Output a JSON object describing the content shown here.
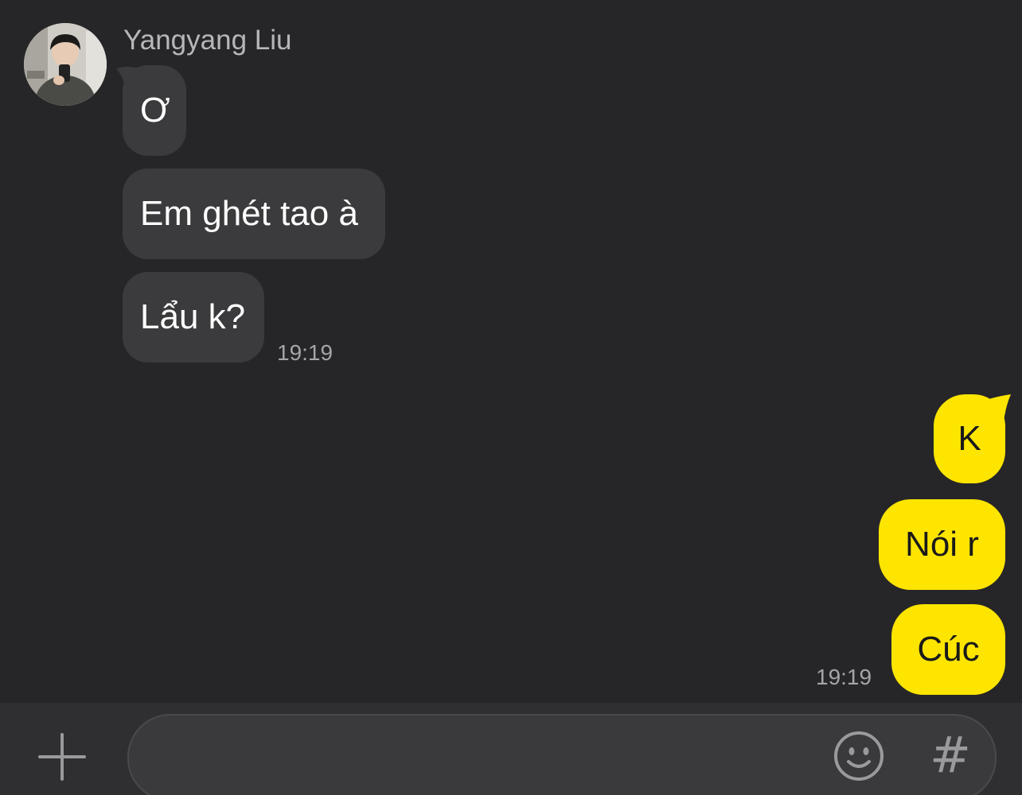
{
  "conversation": {
    "sender": {
      "name": "Yangyang Liu",
      "avatar": "profile-photo"
    },
    "incoming_messages": [
      {
        "text": "Ơ"
      },
      {
        "text": "Em ghét tao à"
      },
      {
        "text": "Lẩu k?"
      }
    ],
    "incoming_time": "19:19",
    "outgoing_messages": [
      {
        "text": "K"
      },
      {
        "text": "Nói r"
      },
      {
        "text": "Cúc"
      }
    ],
    "outgoing_time": "19:19"
  },
  "composer": {
    "value": "",
    "placeholder": "",
    "icons": {
      "attach": "plus-icon",
      "emoji": "emoji-icon",
      "hashtag": "hashtag-icon"
    },
    "hashtag_symbol": "#"
  },
  "colors": {
    "background": "#262628",
    "incoming_bubble": "#3b3b3d",
    "outgoing_bubble": "#fee500",
    "input_bar": "#2f2f31"
  }
}
